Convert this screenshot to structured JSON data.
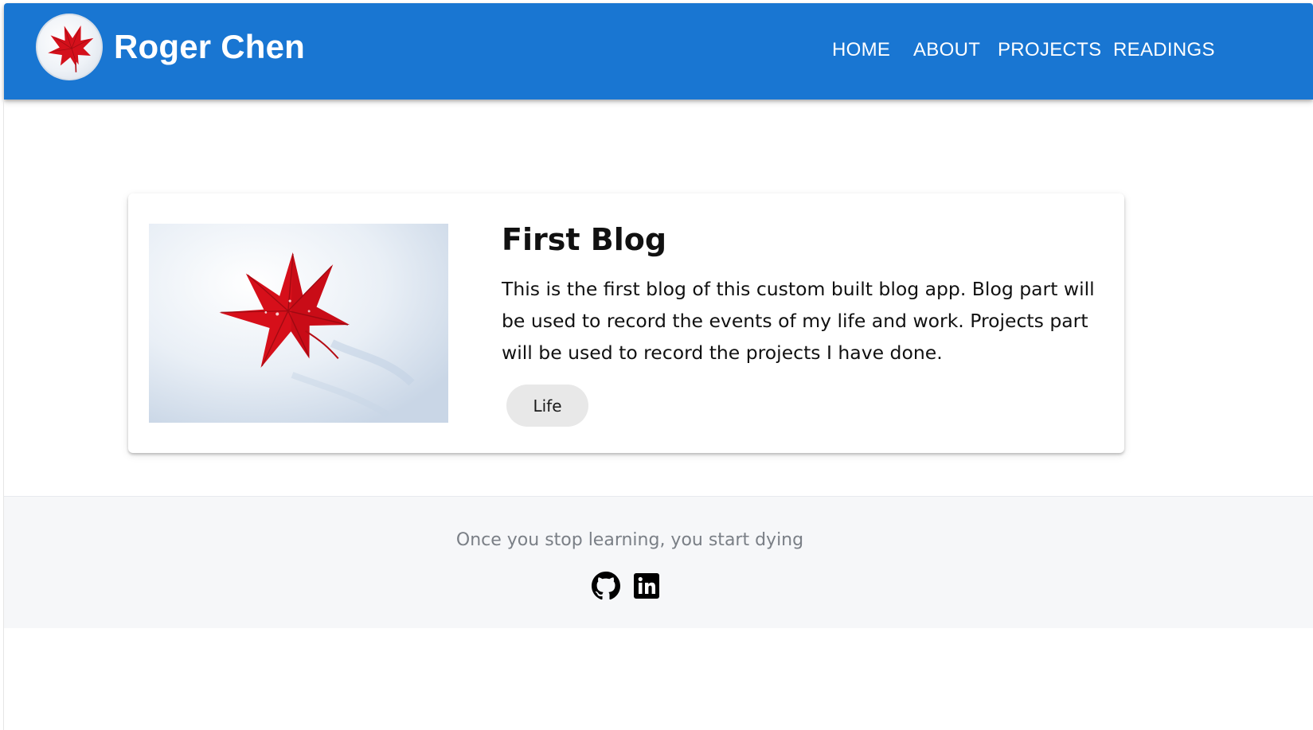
{
  "header": {
    "brand_name": "Roger Chen",
    "avatar_icon": "red-maple-leaf-icon",
    "background_color": "#1976d2",
    "nav": [
      {
        "label": "HOME"
      },
      {
        "label": "ABOUT"
      },
      {
        "label": "PROJECTS"
      },
      {
        "label": "READINGS"
      }
    ]
  },
  "main": {
    "posts": [
      {
        "image": "red-maple-leaf-on-snow",
        "title": "First Blog",
        "excerpt": "This is the first blog of this custom built blog app. Blog part will be used to record the events of my life and work. Projects part will be used to record the projects I have done.",
        "tags": [
          "Life"
        ]
      }
    ]
  },
  "footer": {
    "quote": "Once you stop learning, you start dying",
    "social": [
      {
        "icon": "github-icon"
      },
      {
        "icon": "linkedin-icon"
      }
    ]
  }
}
